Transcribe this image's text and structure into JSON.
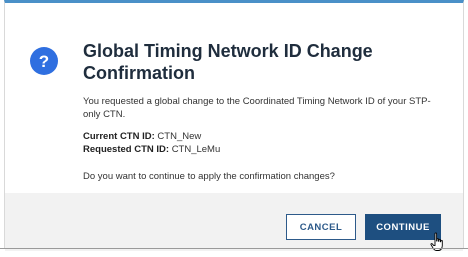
{
  "dialog": {
    "title": "Global Timing Network ID Change Confirmation",
    "intro": "You requested a global change to the Coordinated Timing Network ID of your STP-only CTN.",
    "current_label": "Current CTN ID:",
    "current_value": "CTN_New",
    "requested_label": "Requested CTN ID:",
    "requested_value": "CTN_LeMu",
    "question": "Do you want to continue to apply the confirmation changes?",
    "icon": "help-icon",
    "accent_color": "#2f6fe0"
  },
  "footer": {
    "cancel_label": "CANCEL",
    "continue_label": "CONTINUE",
    "primary_color": "#1e4f80"
  },
  "cursor": {
    "icon": "hand-pointer-icon"
  }
}
